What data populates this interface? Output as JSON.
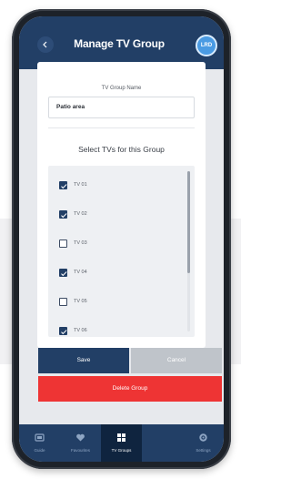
{
  "header": {
    "title": "Manage TV Group",
    "avatar_text": "LRD"
  },
  "form": {
    "name_label": "TV Group Name",
    "name_value": "Patio area",
    "select_title": "Select TVs for this Group"
  },
  "tv_list": [
    {
      "label": "TV 01",
      "checked": true
    },
    {
      "label": "TV 02",
      "checked": true
    },
    {
      "label": "TV 03",
      "checked": false
    },
    {
      "label": "TV 04",
      "checked": true
    },
    {
      "label": "TV 05",
      "checked": false
    },
    {
      "label": "TV 06",
      "checked": true
    }
  ],
  "buttons": {
    "save": "Save",
    "cancel": "Cancel",
    "delete": "Delete Group"
  },
  "tabs": [
    {
      "label": "Guide",
      "icon": "guide-icon",
      "active": false
    },
    {
      "label": "Favourites",
      "icon": "heart-icon",
      "active": false
    },
    {
      "label": "TV Groups",
      "icon": "grid-icon",
      "active": true
    },
    {
      "label": "Settings",
      "icon": "gear-icon",
      "active": false
    }
  ],
  "colors": {
    "header": "#223f66",
    "delete": "#ee3434",
    "cancel": "#bfc4ca"
  }
}
